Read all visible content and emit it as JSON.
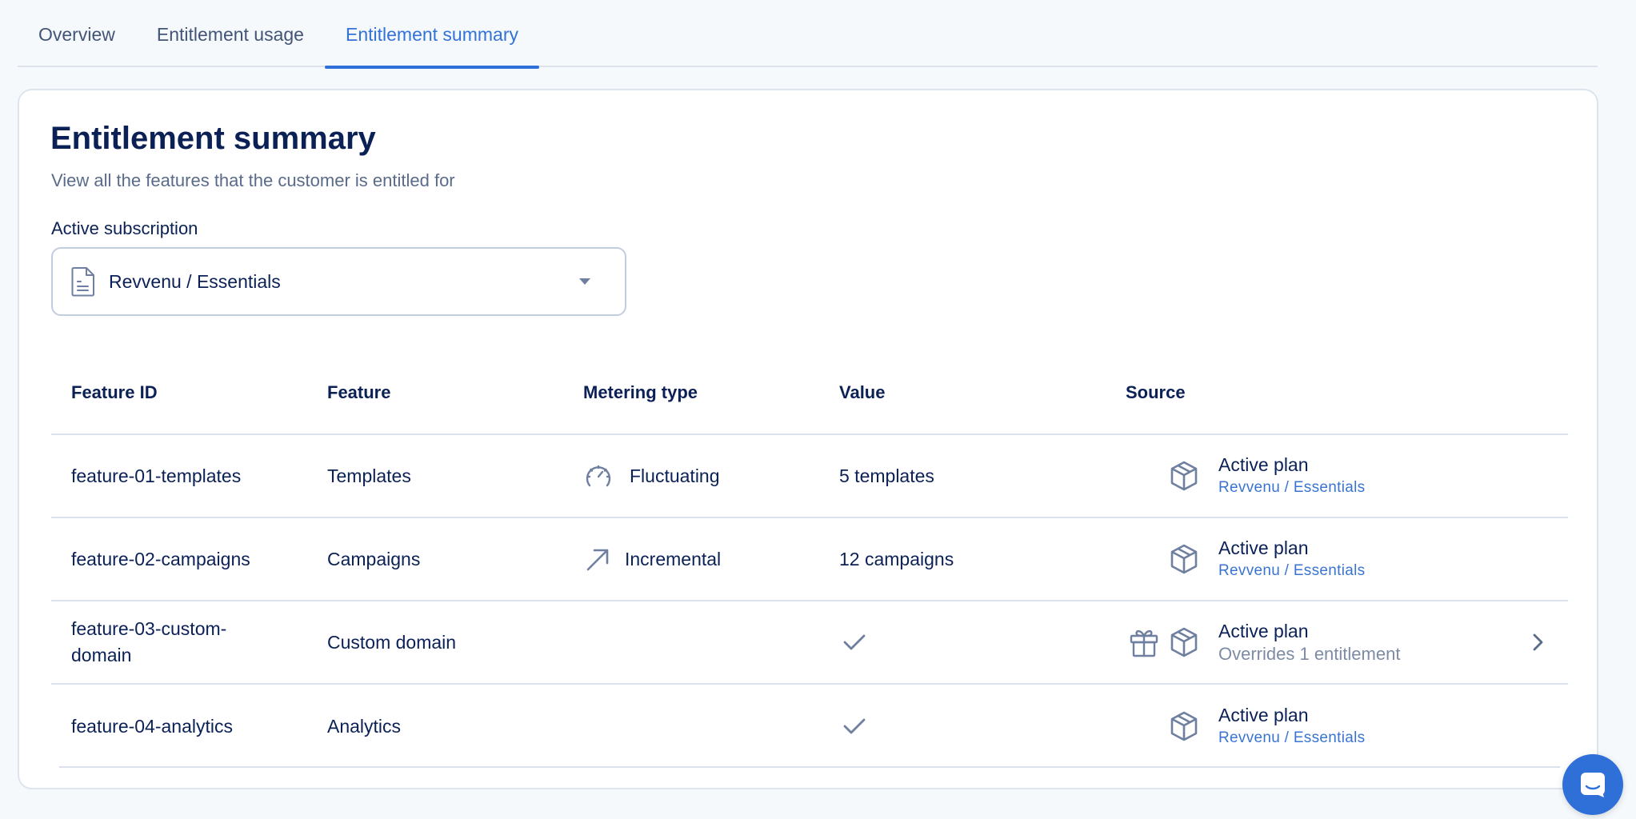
{
  "tabs": [
    {
      "label": "Overview"
    },
    {
      "label": "Entitlement usage"
    },
    {
      "label": "Entitlement summary"
    }
  ],
  "card": {
    "title": "Entitlement summary",
    "subtitle": "View all the features that the customer is entitled for",
    "subscription_label": "Active subscription",
    "subscription_value": "Revvenu / Essentials"
  },
  "table": {
    "headers": [
      "Feature ID",
      "Feature",
      "Metering type",
      "Value",
      "Source"
    ],
    "rows": [
      {
        "feature_id": "feature-01-templates",
        "feature": "Templates",
        "metering_type": "Fluctuating",
        "metering_icon": "speedometer-icon",
        "value": "5 templates",
        "source_title": "Active plan",
        "source_sub": "Revvenu / Essentials"
      },
      {
        "feature_id": "feature-02-campaigns",
        "feature": "Campaigns",
        "metering_type": "Incremental",
        "metering_icon": "arrow-up-right-icon",
        "value": "12 campaigns",
        "source_title": "Active plan",
        "source_sub": "Revvenu / Essentials"
      },
      {
        "feature_id_line1": "feature-03-custom-",
        "feature_id_line2": "domain",
        "feature": "Custom domain",
        "value_icon": "check-icon",
        "source_title": "Active plan",
        "source_sub": "Overrides 1 entitlement"
      },
      {
        "feature_id": "feature-04-analytics",
        "feature": "Analytics",
        "value_icon": "check-icon",
        "source_title": "Active plan",
        "source_sub": "Revvenu / Essentials"
      }
    ]
  },
  "colors": {
    "accent": "#2f6fd8",
    "text_primary": "#0b2156",
    "text_secondary": "#5a6b8a",
    "icon_gray": "#6f7fa0",
    "border": "#dbe2eb"
  }
}
